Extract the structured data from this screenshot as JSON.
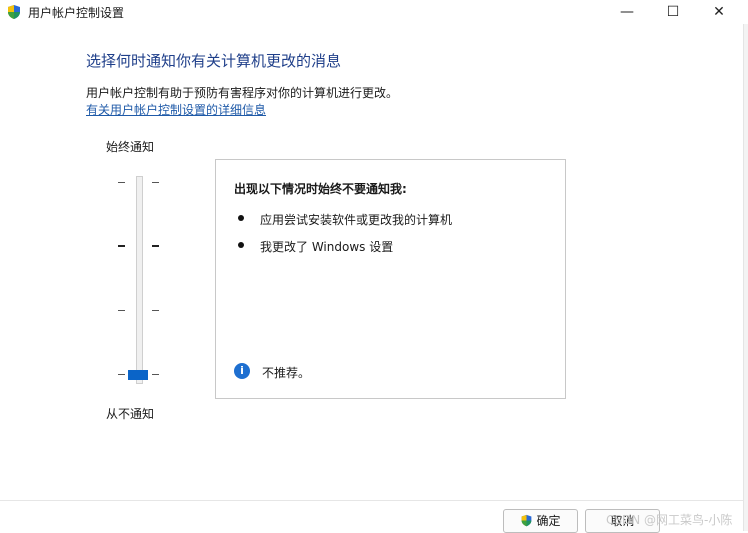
{
  "window": {
    "title": "用户帐户控制设置",
    "min_symbol": "—",
    "max_symbol": "☐",
    "close_symbol": "✕"
  },
  "main": {
    "heading": "选择何时通知你有关计算机更改的消息",
    "description": "用户帐户控制有助于预防有害程序对你的计算机进行更改。",
    "link": "有关用户帐户控制设置的详细信息"
  },
  "slider": {
    "top_label": "始终通知",
    "bottom_label": "从不通知",
    "level": 0
  },
  "panel": {
    "title": "出现以下情况时始终不要通知我:",
    "bullets": [
      "应用尝试安装软件或更改我的计算机",
      "我更改了 Windows 设置"
    ],
    "note": "不推荐。",
    "note_icon": "info-icon"
  },
  "footer": {
    "ok": "确定",
    "cancel": "取消",
    "watermark": "CSDN @网工菜鸟-小陈"
  },
  "colors": {
    "heading": "#1f3f8a",
    "link": "#1f5aa8",
    "accent": "#0a64c8"
  }
}
